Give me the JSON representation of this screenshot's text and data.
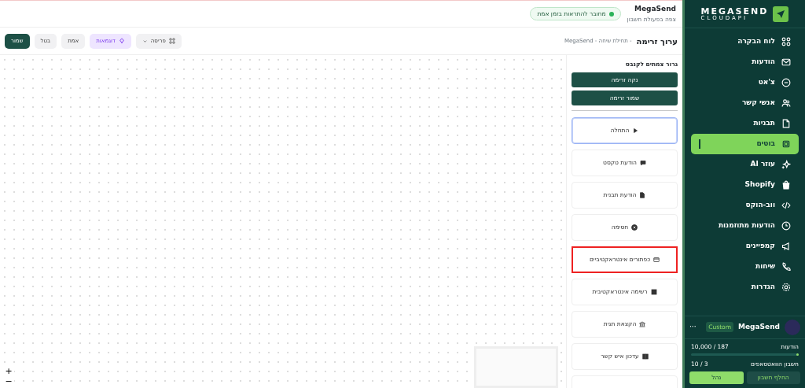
{
  "sidebar": {
    "logo": {
      "title": "MEGASEND",
      "subtitle": "CLOUDAPI"
    },
    "items": [
      {
        "label": "לוח הבקרה",
        "selected": false
      },
      {
        "label": "הודעות",
        "selected": false
      },
      {
        "label": "צ'אט",
        "selected": false
      },
      {
        "label": "אנשי קשר",
        "selected": false
      },
      {
        "label": "תבניות",
        "selected": false
      },
      {
        "label": "בוטים",
        "selected": true
      },
      {
        "label": "עוזר AI",
        "selected": false
      },
      {
        "label": "Shopify",
        "selected": false
      },
      {
        "label": "ווב-הוקס",
        "selected": false
      },
      {
        "label": "הודעות מתוזמנות",
        "selected": false
      },
      {
        "label": "קמפיינים",
        "selected": false
      },
      {
        "label": "שיחות",
        "selected": false
      },
      {
        "label": "הגדרות",
        "selected": false
      }
    ],
    "account": {
      "name": "MegaSend",
      "plan": "Custom",
      "menu": "···"
    },
    "usage": [
      {
        "label": "הודעות",
        "reading": "10,000 / 187",
        "level": 0.02
      },
      {
        "label": "חשבון הוואטסאפים",
        "reading": "10 / 3"
      }
    ],
    "buttons": [
      {
        "label": "החלף חשבון",
        "kind": "secondary"
      },
      {
        "label": "נהל",
        "kind": "primary"
      }
    ]
  },
  "header": {
    "account": "MegaSend",
    "subtitle": "צפה בפעולת חשבון",
    "status": "מחובר להתראות בזמן אמת"
  },
  "toolbar": {
    "title": "ערוך זרימה",
    "breadcrumb": "- תחילת שיחה - MegaSend",
    "buttons": [
      {
        "label": "פריסה",
        "kind": "layout"
      },
      {
        "label": "דוגמאות",
        "kind": "examples"
      },
      {
        "label": "אמת",
        "kind": "plain"
      },
      {
        "label": "בטל",
        "kind": "plain"
      },
      {
        "label": "שמור",
        "kind": "primary"
      }
    ]
  },
  "palette": {
    "title": "גרור צמתים לקנבס",
    "actions": [
      "נקה זרימה",
      "שמור זרימה"
    ],
    "nodes": [
      {
        "label": "התחלה",
        "selected": true,
        "highlighted": false
      },
      {
        "label": "הודעת טקסט",
        "selected": false,
        "highlighted": false
      },
      {
        "label": "הודעת תבנית",
        "selected": false,
        "highlighted": false
      },
      {
        "label": "חסימה",
        "selected": false,
        "highlighted": false
      },
      {
        "label": "כפתורים אינטראקטיביים",
        "selected": false,
        "highlighted": true
      },
      {
        "label": "רשימה אינטראקטיבית",
        "selected": false,
        "highlighted": false
      },
      {
        "label": "הקצאת תגית",
        "selected": false,
        "highlighted": false
      },
      {
        "label": "עדכון איש קשר",
        "selected": false,
        "highlighted": false
      }
    ]
  },
  "canvas": {
    "zoom_in": "+",
    "zoom_out": "−"
  }
}
